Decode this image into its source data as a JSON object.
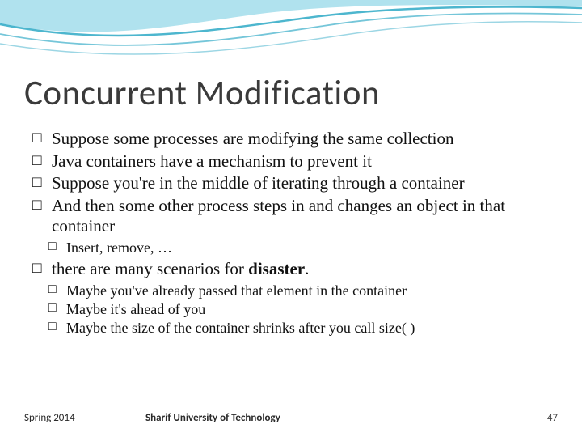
{
  "title": "Concurrent Modification",
  "bullets": {
    "b1": "Suppose some processes are modifying the same collection",
    "b2": "Java containers have a mechanism to prevent it",
    "b3": "Suppose you're in the middle of iterating through a container",
    "b4": "And then some other process steps in and changes an object in that container",
    "b4_1": "Insert, remove, …",
    "b5_pre": "there are many scenarios for ",
    "b5_bold": "disaster",
    "b5_post": ".",
    "b5_1": "Maybe you've already passed that element in the container",
    "b5_2": "Maybe it's ahead of you",
    "b5_3": "Maybe the size of the container shrinks after you call size( )"
  },
  "footer": {
    "term": "Spring 2014",
    "institution": "Sharif University of Technology",
    "slide_number": "47"
  }
}
